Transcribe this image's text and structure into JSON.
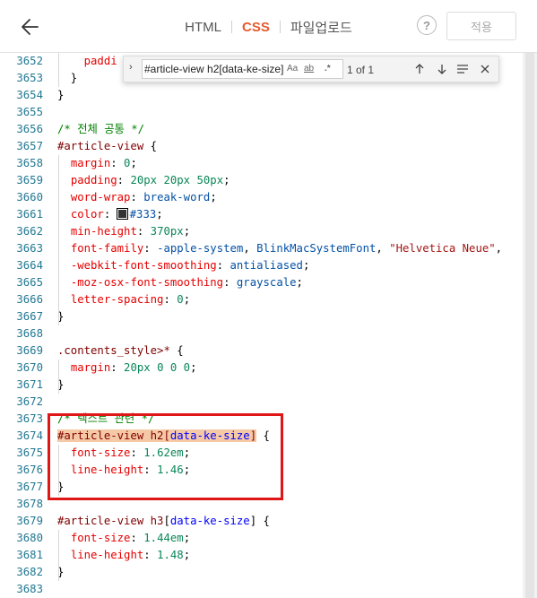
{
  "header": {
    "back_icon": "arrow-left-icon",
    "tabs": [
      {
        "label": "HTML",
        "active": false
      },
      {
        "label": "CSS",
        "active": true
      },
      {
        "label": "파일업로드",
        "active": false
      }
    ],
    "help_label": "?",
    "apply_label": "적용"
  },
  "find_widget": {
    "query": "#article-view h2[data-ke-size]",
    "match_case_label": "Aa",
    "whole_word_label": "ab",
    "regex_label": ".*",
    "result_count": "1 of 1",
    "toggle_icon": "chevron-right-icon",
    "prev_icon": "arrow-up-icon",
    "next_icon": "arrow-down-icon",
    "selection_icon": "lines-icon",
    "close_icon": "close-icon"
  },
  "colors": {
    "accent": "#e65a2d",
    "line_number": "#237893",
    "highlight_border": "#e01515",
    "match_background": "#f6c9a6"
  },
  "editor": {
    "lines": [
      {
        "num": "3652",
        "tokens": [
          {
            "t": "    "
          },
          {
            "t": "paddi",
            "c": "c-prop"
          }
        ]
      },
      {
        "num": "3653",
        "tokens": [
          {
            "t": "  }"
          }
        ]
      },
      {
        "num": "3654",
        "tokens": [
          {
            "t": "}"
          }
        ]
      },
      {
        "num": "3655",
        "tokens": []
      },
      {
        "num": "3656",
        "tokens": [
          {
            "t": "/* 전체 공통 */",
            "c": "c-comment"
          }
        ]
      },
      {
        "num": "3657",
        "tokens": [
          {
            "t": "#article-view",
            "c": "c-sel"
          },
          {
            "t": " {"
          }
        ]
      },
      {
        "num": "3658",
        "tokens": [
          {
            "t": "  "
          },
          {
            "t": "margin",
            "c": "c-prop"
          },
          {
            "t": ": "
          },
          {
            "t": "0",
            "c": "c-num"
          },
          {
            "t": ";"
          }
        ]
      },
      {
        "num": "3659",
        "tokens": [
          {
            "t": "  "
          },
          {
            "t": "padding",
            "c": "c-prop"
          },
          {
            "t": ": "
          },
          {
            "t": "20px 20px 50px",
            "c": "c-num"
          },
          {
            "t": ";"
          }
        ]
      },
      {
        "num": "3660",
        "tokens": [
          {
            "t": "  "
          },
          {
            "t": "word-wrap",
            "c": "c-prop"
          },
          {
            "t": ": "
          },
          {
            "t": "break-word",
            "c": "c-val"
          },
          {
            "t": ";"
          }
        ]
      },
      {
        "num": "3661",
        "tokens": [
          {
            "t": "  "
          },
          {
            "t": "color",
            "c": "c-prop"
          },
          {
            "t": ": "
          },
          {
            "t": "",
            "swatch": true
          },
          {
            "t": "#333",
            "c": "c-val"
          },
          {
            "t": ";"
          }
        ]
      },
      {
        "num": "3662",
        "tokens": [
          {
            "t": "  "
          },
          {
            "t": "min-height",
            "c": "c-prop"
          },
          {
            "t": ": "
          },
          {
            "t": "370px",
            "c": "c-num"
          },
          {
            "t": ";"
          }
        ]
      },
      {
        "num": "3663",
        "tokens": [
          {
            "t": "  "
          },
          {
            "t": "font-family",
            "c": "c-prop"
          },
          {
            "t": ": "
          },
          {
            "t": "-apple-system",
            "c": "c-val"
          },
          {
            "t": ", "
          },
          {
            "t": "BlinkMacSystemFont",
            "c": "c-val"
          },
          {
            "t": ", "
          },
          {
            "t": "\"Helvetica Neue\"",
            "c": "c-str"
          },
          {
            "t": ","
          }
        ]
      },
      {
        "num": "3664",
        "tokens": [
          {
            "t": "  "
          },
          {
            "t": "-webkit-font-smoothing",
            "c": "c-prop"
          },
          {
            "t": ": "
          },
          {
            "t": "antialiased",
            "c": "c-val"
          },
          {
            "t": ";"
          }
        ]
      },
      {
        "num": "3665",
        "tokens": [
          {
            "t": "  "
          },
          {
            "t": "-moz-osx-font-smoothing",
            "c": "c-prop"
          },
          {
            "t": ": "
          },
          {
            "t": "grayscale",
            "c": "c-val"
          },
          {
            "t": ";"
          }
        ]
      },
      {
        "num": "3666",
        "tokens": [
          {
            "t": "  "
          },
          {
            "t": "letter-spacing",
            "c": "c-prop"
          },
          {
            "t": ": "
          },
          {
            "t": "0",
            "c": "c-num"
          },
          {
            "t": ";"
          }
        ]
      },
      {
        "num": "3667",
        "tokens": [
          {
            "t": "}"
          }
        ]
      },
      {
        "num": "3668",
        "tokens": []
      },
      {
        "num": "3669",
        "tokens": [
          {
            "t": ".contents_style>*",
            "c": "c-sel"
          },
          {
            "t": " {"
          }
        ]
      },
      {
        "num": "3670",
        "tokens": [
          {
            "t": "  "
          },
          {
            "t": "margin",
            "c": "c-prop"
          },
          {
            "t": ": "
          },
          {
            "t": "20px 0 0 0",
            "c": "c-num"
          },
          {
            "t": ";"
          }
        ]
      },
      {
        "num": "3671",
        "tokens": [
          {
            "t": "}"
          }
        ]
      },
      {
        "num": "3672",
        "tokens": []
      },
      {
        "num": "3673",
        "tokens": [
          {
            "t": "/* 텍스트 관련 */",
            "c": "c-comment"
          }
        ]
      },
      {
        "num": "3674",
        "tokens": [
          {
            "t": "#article-view h2",
            "c": "c-sel",
            "match": true
          },
          {
            "t": "[",
            "c": "c-sel",
            "match": true
          },
          {
            "t": "data-ke-size",
            "c": "c-attr",
            "match": true
          },
          {
            "t": "]",
            "c": "c-sel",
            "match": true
          },
          {
            "t": " {"
          }
        ]
      },
      {
        "num": "3675",
        "tokens": [
          {
            "t": "  "
          },
          {
            "t": "font-size",
            "c": "c-prop"
          },
          {
            "t": ": "
          },
          {
            "t": "1.62em",
            "c": "c-num"
          },
          {
            "t": ";"
          }
        ]
      },
      {
        "num": "3676",
        "tokens": [
          {
            "t": "  "
          },
          {
            "t": "line-height",
            "c": "c-prop"
          },
          {
            "t": ": "
          },
          {
            "t": "1.46",
            "c": "c-num"
          },
          {
            "t": ";"
          }
        ]
      },
      {
        "num": "3677",
        "tokens": [
          {
            "t": "}"
          }
        ]
      },
      {
        "num": "3678",
        "tokens": []
      },
      {
        "num": "3679",
        "tokens": [
          {
            "t": "#article-view h3",
            "c": "c-sel"
          },
          {
            "t": "["
          },
          {
            "t": "data-ke-size",
            "c": "c-attr"
          },
          {
            "t": "]"
          },
          {
            "t": " {"
          }
        ]
      },
      {
        "num": "3680",
        "tokens": [
          {
            "t": "  "
          },
          {
            "t": "font-size",
            "c": "c-prop"
          },
          {
            "t": ": "
          },
          {
            "t": "1.44em",
            "c": "c-num"
          },
          {
            "t": ";"
          }
        ]
      },
      {
        "num": "3681",
        "tokens": [
          {
            "t": "  "
          },
          {
            "t": "line-height",
            "c": "c-prop"
          },
          {
            "t": ": "
          },
          {
            "t": "1.48",
            "c": "c-num"
          },
          {
            "t": ";"
          }
        ]
      },
      {
        "num": "3682",
        "tokens": [
          {
            "t": "}"
          }
        ]
      },
      {
        "num": "3683",
        "tokens": []
      }
    ]
  }
}
